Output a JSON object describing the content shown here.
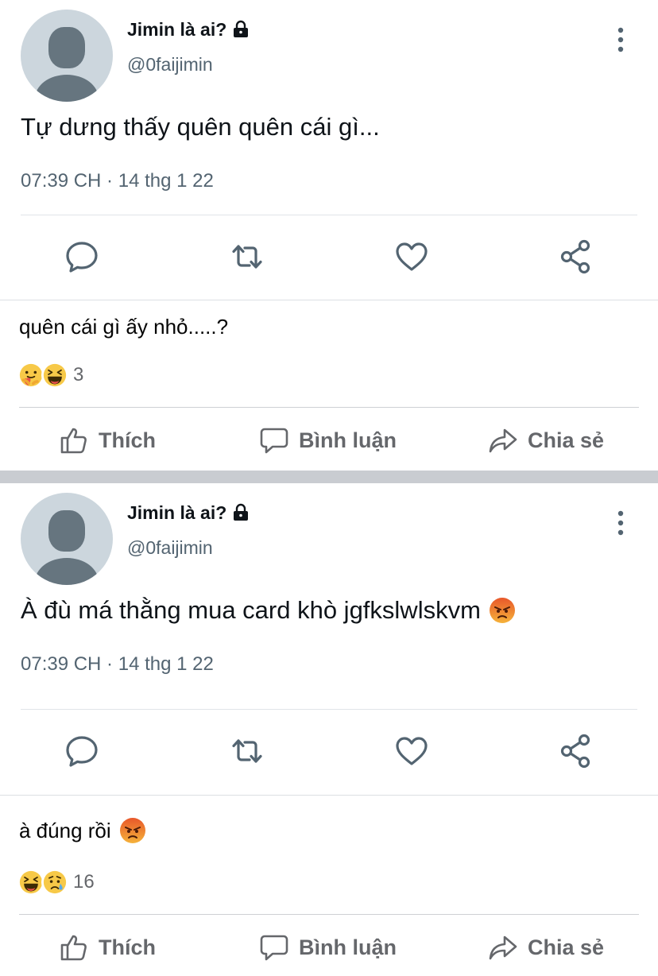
{
  "posts": [
    {
      "tweet": {
        "name": "Jimin là ai?",
        "handle": "@0faijimin",
        "text": "Tự dưng thấy quên quên cái gì...",
        "meta": "07:39 CH · 14 thg 1 22"
      },
      "caption": "quên cái gì ấy nhỏ.....?",
      "reactions": {
        "icons": [
          "care-reaction",
          "haha-reaction"
        ],
        "count": "3"
      },
      "actions": {
        "like": "Thích",
        "comment": "Bình luận",
        "share": "Chia sẻ"
      }
    },
    {
      "tweet": {
        "name": "Jimin là ai?",
        "handle": "@0faijimin",
        "text": "À đù má thằng mua card khò jgfkslwlskvm",
        "meta": "07:39 CH · 14 thg 1 22"
      },
      "caption": "à đúng rồi",
      "reactions": {
        "icons": [
          "haha-reaction",
          "sad-reaction"
        ],
        "count": "16"
      },
      "actions": {
        "like": "Thích",
        "comment": "Bình luận",
        "share": "Chia sẻ"
      }
    }
  ],
  "colors": {
    "name": "#0f1419",
    "secondary": "#536471",
    "fb_gray": "#65676b",
    "separator": "#c9ccd1"
  }
}
